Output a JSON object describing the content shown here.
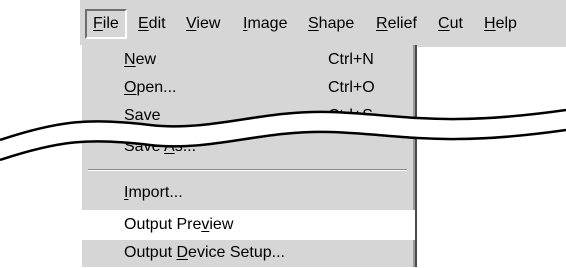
{
  "menubar": {
    "items": [
      {
        "pre": "",
        "u": "F",
        "post": "ile"
      },
      {
        "pre": "",
        "u": "E",
        "post": "dit"
      },
      {
        "pre": "",
        "u": "V",
        "post": "iew"
      },
      {
        "pre": "",
        "u": "I",
        "post": "mage"
      },
      {
        "pre": "",
        "u": "S",
        "post": "hape"
      },
      {
        "pre": "",
        "u": "R",
        "post": "elief"
      },
      {
        "pre": "",
        "u": "C",
        "post": "ut"
      },
      {
        "pre": "",
        "u": "H",
        "post": "elp"
      }
    ]
  },
  "file_menu": {
    "items": [
      {
        "pre": "",
        "u": "N",
        "post": "ew",
        "shortcut": "Ctrl+N"
      },
      {
        "pre": "",
        "u": "O",
        "post": "pen...",
        "shortcut": "Ctrl+O"
      },
      {
        "pre": "",
        "u": "S",
        "post": "ave",
        "shortcut": "Ctrl+S"
      },
      {
        "pre": "Save ",
        "u": "A",
        "post": "s...",
        "shortcut": ""
      },
      {
        "pre": "",
        "u": "I",
        "post": "mport...",
        "shortcut": ""
      },
      {
        "pre": "Output Pre",
        "u": "v",
        "post": "iew",
        "shortcut": ""
      },
      {
        "pre": "Output ",
        "u": "D",
        "post": "evice Setup...",
        "shortcut": ""
      }
    ]
  },
  "colors": {
    "menu_background": "#d6d6d6",
    "highlight": "#ffffff"
  }
}
